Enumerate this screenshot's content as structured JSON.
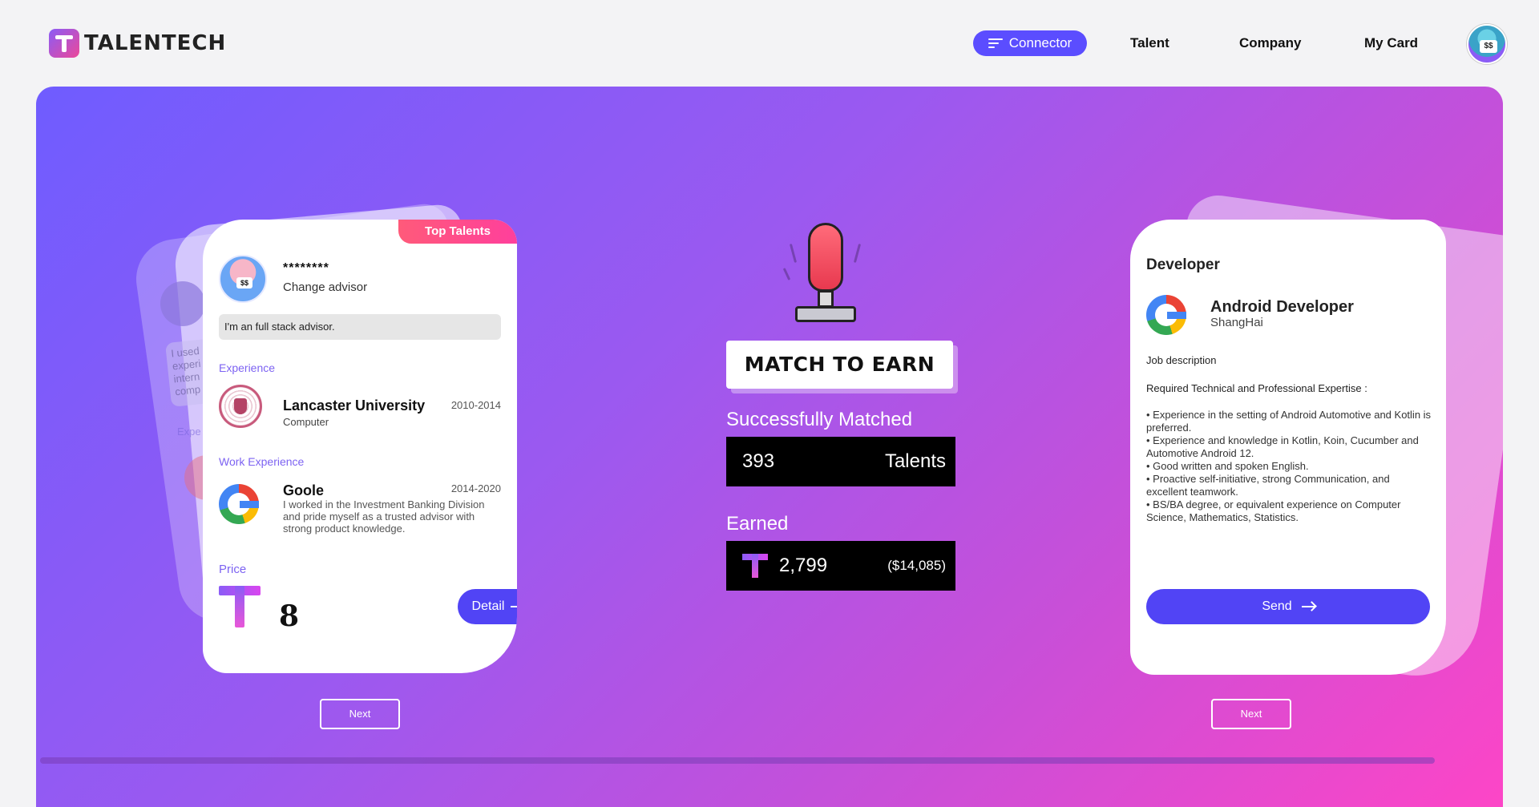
{
  "header": {
    "logo_text": "TALENTECH",
    "nav": [
      {
        "label": "Connector",
        "active": true
      },
      {
        "label": "Talent"
      },
      {
        "label": "Company"
      },
      {
        "label": "My Card"
      }
    ],
    "avatar_badge": "$$"
  },
  "left_card": {
    "ribbon": "Top Talents",
    "name": "********",
    "role": "Change advisor",
    "avatar_badge": "$$",
    "bio": "I'm an full stack advisor.",
    "experience_label": "Experience",
    "education": {
      "name": "Lancaster University",
      "sub": "Computer",
      "years": "2010-2014"
    },
    "work_label": "Work Experience",
    "work": {
      "name": "Goole",
      "years": "2014-2020",
      "desc": "I worked in the Investment Banking Division and pride myself as a trusted advisor with strong product knowledge."
    },
    "price_label": "Price",
    "price": "8",
    "detail_button": "Detail",
    "next_button": "Next",
    "ghost_text": "I used experi intern comp",
    "ghost_label": "Expe"
  },
  "center": {
    "title": "MATCH TO EARN",
    "matched_label": "Successfully Matched",
    "matched_value": "393",
    "matched_unit": "Talents",
    "earned_label": "Earned",
    "earned_value": "2,799",
    "earned_usd": "($14,085)"
  },
  "right_card": {
    "category": "Developer",
    "job_title": "Android Developer",
    "location": "ShangHai",
    "job_desc_label": "Job description",
    "req_label": "Required Technical and Professional Expertise :",
    "requirements": [
      "• Experience in the setting of Android Automotive and Kotlin is preferred.",
      "• Experience and knowledge in Kotlin, Koin, Cucumber and Automotive Android 12.",
      "• Good written and spoken English.",
      "• Proactive self-initiative, strong Communication, and excellent teamwork.",
      "• BS/BA degree, or equivalent experience on Computer Science, Mathematics, Statistics."
    ],
    "send_button": "Send",
    "next_button": "Next"
  },
  "colors": {
    "accent": "#5144f5",
    "gradient_start": "#6f5cff",
    "gradient_end": "#ff45c6",
    "ribbon": "#ff4f8f",
    "section_label": "#7d63f2"
  }
}
